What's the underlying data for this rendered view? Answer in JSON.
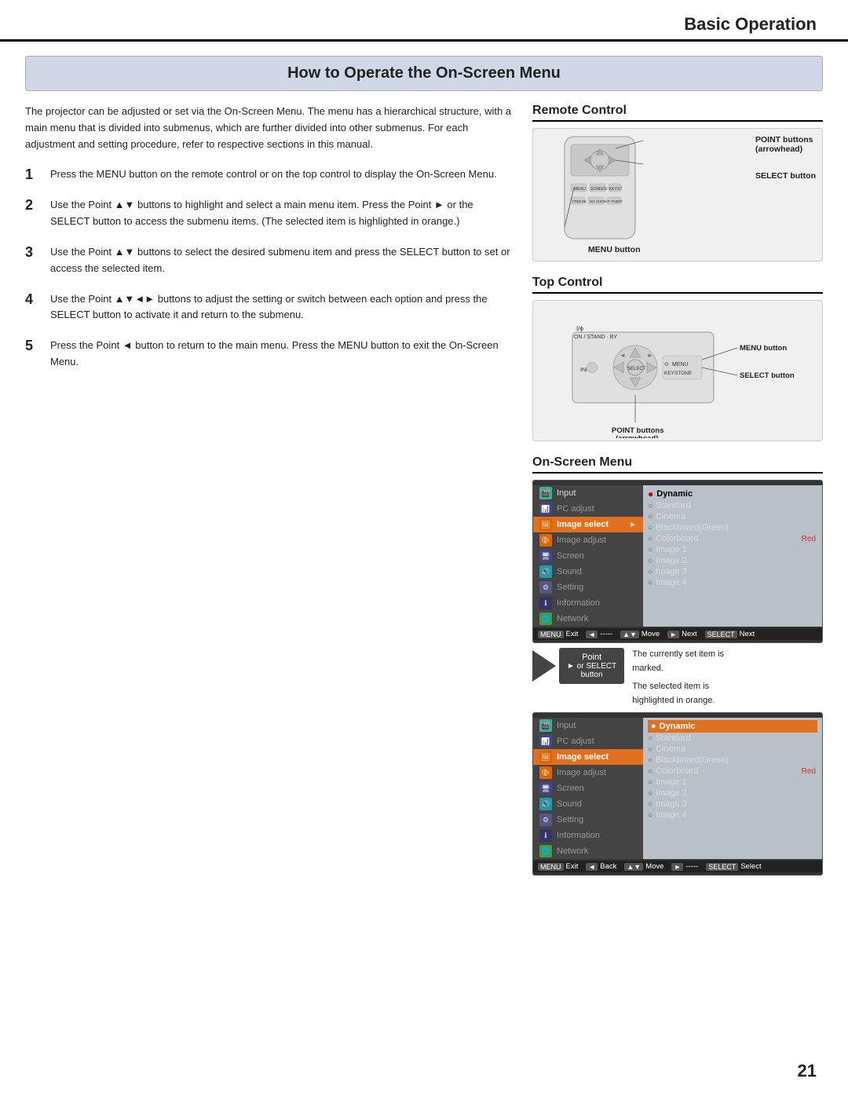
{
  "header": {
    "title": "Basic Operation"
  },
  "main_title": "How to Operate the On-Screen Menu",
  "intro": "The projector can be adjusted or set via the On-Screen Menu. The menu has a hierarchical structure, with a main menu that is divided into submenus, which are further divided into other submenus. For each adjustment and setting procedure, refer to respective sections in this manual.",
  "steps": [
    {
      "num": "1",
      "text": "Press the MENU button on the remote control or on the top control to display the On-Screen Menu."
    },
    {
      "num": "2",
      "text": "Use the Point ▲▼ buttons to highlight and select a main menu item. Press the Point ► or the SELECT button to access the submenu items. (The selected item is highlighted in orange.)"
    },
    {
      "num": "3",
      "text": "Use the Point ▲▼ buttons to select the desired submenu item and press the SELECT button to set or access the selected item."
    },
    {
      "num": "4",
      "text": "Use the Point ▲▼◄► buttons to adjust the setting or switch between each option and press the SELECT button to activate it and return to the submenu."
    },
    {
      "num": "5",
      "text": "Press the Point ◄ button to return to the main menu. Press the MENU button to exit the On-Screen Menu."
    }
  ],
  "remote_control": {
    "section_title": "Remote Control",
    "labels": {
      "point_buttons": "POINT buttons",
      "arrowhead": "(arrowhead)",
      "select_button": "SELECT button",
      "menu_button": "MENU button"
    }
  },
  "top_control": {
    "section_title": "Top Control",
    "labels": {
      "menu_button": "MENU button",
      "select_button": "SELECT button",
      "point_buttons": "POINT buttons",
      "arrowhead": "(arrowhead)"
    }
  },
  "onscreen_menu": {
    "section_title": "On-Screen Menu",
    "menu_items": [
      {
        "label": "Input",
        "icon_type": "green"
      },
      {
        "label": "PC adjust",
        "icon_type": "blue"
      },
      {
        "label": "Image select",
        "icon_type": "orange",
        "active": true
      },
      {
        "label": "Image adjust",
        "icon_type": "orange"
      },
      {
        "label": "Screen",
        "icon_type": "blue2"
      },
      {
        "label": "Sound",
        "icon_type": "teal"
      },
      {
        "label": "Setting",
        "icon_type": "purple"
      },
      {
        "label": "Information",
        "icon_type": "info"
      },
      {
        "label": "Network",
        "icon_type": "net"
      }
    ],
    "submenu_items": [
      {
        "label": "Dynamic",
        "marker": "dot",
        "highlighted": true
      },
      {
        "label": "Standard",
        "marker": "circle"
      },
      {
        "label": "Cinema",
        "marker": "circle"
      },
      {
        "label": "Blackboard(Green)",
        "marker": "circle"
      },
      {
        "label": "Colorboard",
        "marker": "circle",
        "red_label": "Red"
      },
      {
        "label": "Image 1",
        "marker": "circle"
      },
      {
        "label": "Image 2",
        "marker": "circle"
      },
      {
        "label": "Image 3",
        "marker": "circle"
      },
      {
        "label": "Image 4",
        "marker": "circle"
      }
    ],
    "footer_items": [
      {
        "key": "MENU",
        "label": "Exit"
      },
      {
        "key": "◄",
        "label": "-----"
      },
      {
        "key": "▲▼",
        "label": "Move"
      },
      {
        "key": "►",
        "label": "Next"
      },
      {
        "key": "SELECT",
        "label": "Next"
      }
    ],
    "footer_items2": [
      {
        "key": "MENU",
        "label": "Exit"
      },
      {
        "key": "◄",
        "label": "Back"
      },
      {
        "key": "▲▼",
        "label": "Move"
      },
      {
        "key": "►",
        "label": "-----"
      },
      {
        "key": "SELECT",
        "label": "Select"
      }
    ]
  },
  "callout": {
    "arrow_label": "Point\n► or SELECT\nbutton",
    "text1": "The currently set item is",
    "text2": "marked.",
    "text3": "The selected item is",
    "text4": "highlighted in orange."
  },
  "page_number": "21"
}
